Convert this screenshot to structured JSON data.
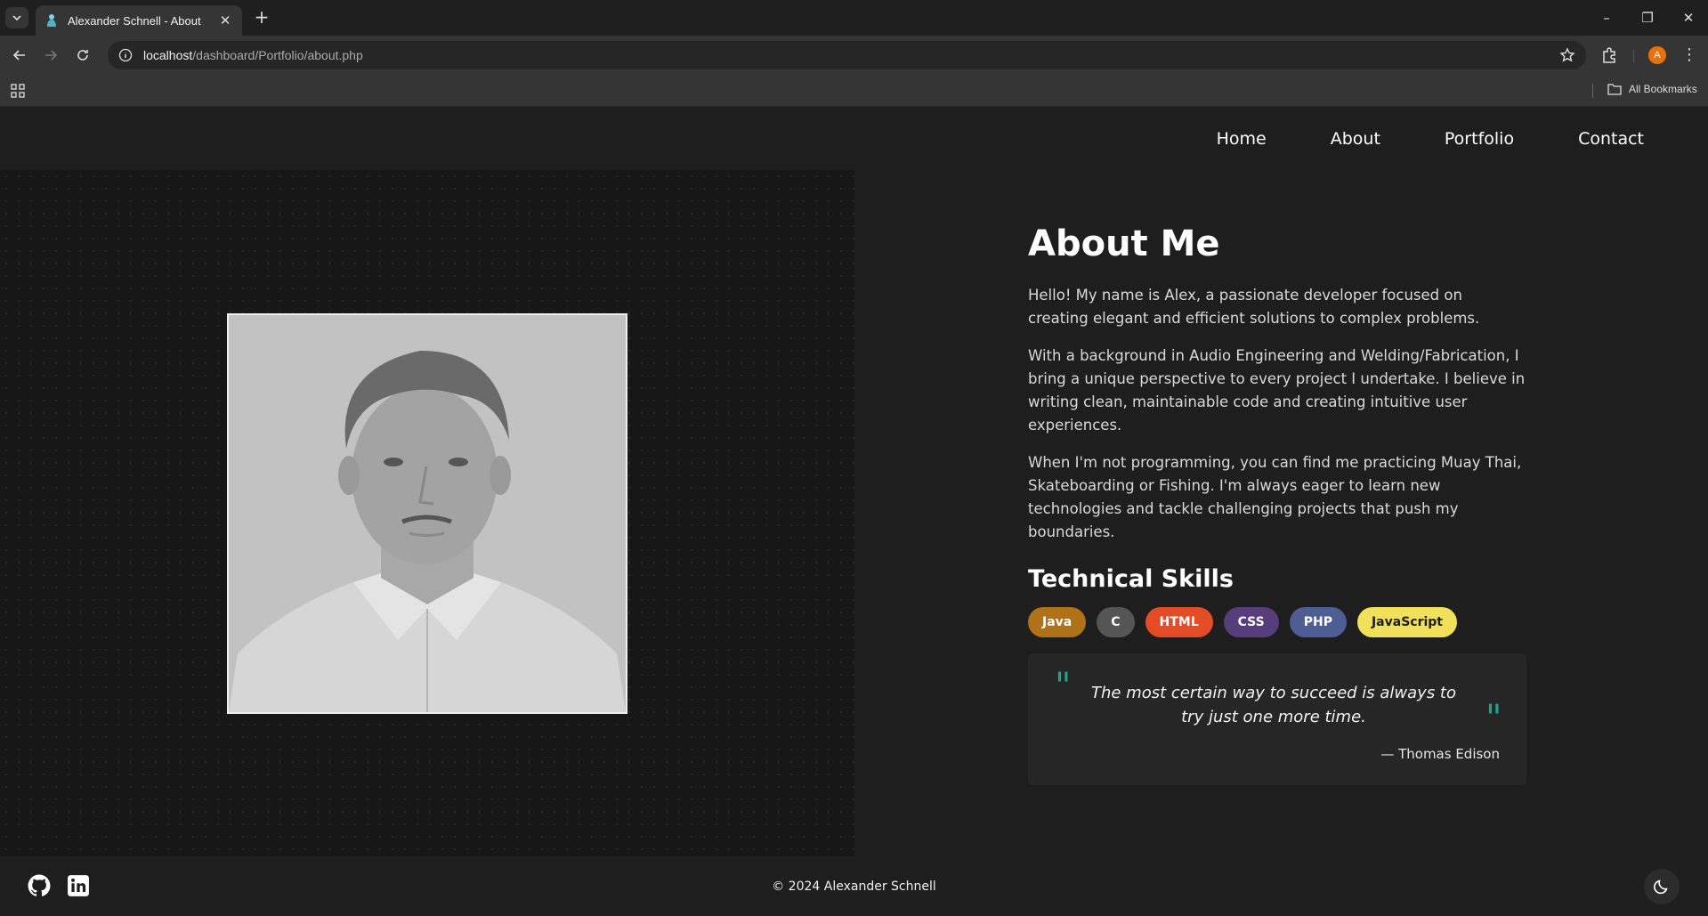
{
  "browser": {
    "tab_title": "Alexander Schnell - About",
    "url_host": "localhost",
    "url_path": "/dashboard/Portfolio/about.php",
    "profile_initial": "A",
    "all_bookmarks_label": "All Bookmarks"
  },
  "nav": {
    "items": [
      "Home",
      "About",
      "Portfolio",
      "Contact"
    ]
  },
  "about": {
    "title": "About Me",
    "paragraphs": [
      "Hello! My name is Alex, a passionate developer focused on creating elegant and efficient solutions to complex problems.",
      "With a background in Audio Engineering and Welding/Fabrication, I bring a unique perspective to every project I undertake. I believe in writing clean, maintainable code and creating intuitive user experiences.",
      "When I'm not programming, you can find me practicing Muay Thai, Skateboarding or Fishing. I'm always eager to learn new technologies and tackle challenging projects that push my boundaries."
    ],
    "skills_title": "Technical Skills",
    "skills": [
      {
        "label": "Java",
        "bg": "#b07219",
        "fg": "#ffffff"
      },
      {
        "label": "C",
        "bg": "#555555",
        "fg": "#ffffff"
      },
      {
        "label": "HTML",
        "bg": "#e34c26",
        "fg": "#ffffff"
      },
      {
        "label": "CSS",
        "bg": "#563d7c",
        "fg": "#ffffff"
      },
      {
        "label": "PHP",
        "bg": "#4f5d95",
        "fg": "#ffffff"
      },
      {
        "label": "JavaScript",
        "bg": "#f1e05a",
        "fg": "#1e1e1e"
      }
    ]
  },
  "quote": {
    "text": "The most certain way to succeed is always to try just one more time.",
    "author": "— Thomas Edison",
    "accent": "#1ea58f"
  },
  "footer": {
    "copyright": "© 2024 Alexander Schnell",
    "social": [
      "github-icon",
      "linkedin-icon"
    ]
  },
  "theme": {
    "page_bg": "#1e1e1e",
    "toggle_icon": "moon-icon"
  }
}
